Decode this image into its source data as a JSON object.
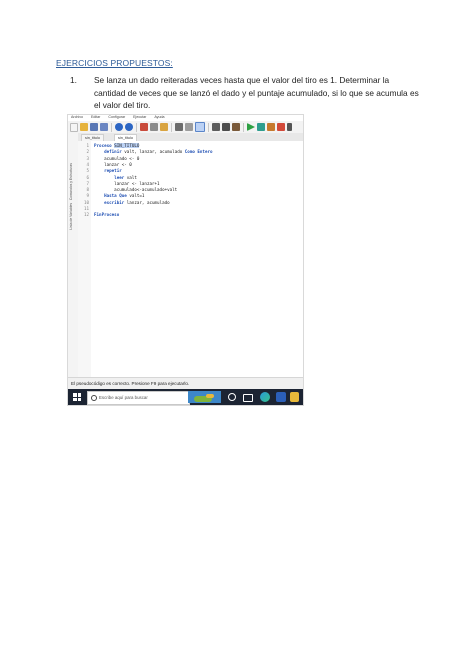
{
  "document": {
    "heading": "EJERCICIOS PROPUESTOS:",
    "item_number": "1.",
    "item_text": "Se lanza un dado reiteradas veces hasta que el valor del tiro es 1. Determinar la cantidad de veces que se lanzó el dado y el puntaje acumulado, si lo que se acumula es el valor del tiro."
  },
  "screenshot": {
    "menu": [
      "Archivo",
      "Editar",
      "Configurar",
      "Ejecutar",
      "Ayuda"
    ],
    "tabs": [
      "sin_titulo",
      "sin_titulo"
    ],
    "side_labels": [
      "Lista de Variables",
      "Comandos y Estructuras"
    ],
    "code_lines": [
      {
        "n": "1",
        "text": "Proceso SIN_TITULO"
      },
      {
        "n": "2",
        "text": "    definir valt, lanzar, acumulado Como Entero"
      },
      {
        "n": "3",
        "text": "    acumulado <- 0"
      },
      {
        "n": "4",
        "text": "    lanzar <- 0"
      },
      {
        "n": "5",
        "text": "    repetir"
      },
      {
        "n": "6",
        "text": "        leer valt"
      },
      {
        "n": "7",
        "text": "        lanzar <- lanzar+1"
      },
      {
        "n": "8",
        "text": "        acumulado<-acumulado+valt"
      },
      {
        "n": "9",
        "text": "    Hasta Que valt=1"
      },
      {
        "n": "10",
        "text": "    escribir lanzar, acumulado"
      },
      {
        "n": "11",
        "text": ""
      },
      {
        "n": "12",
        "text": "FinProceso"
      }
    ],
    "status": "El pseudocódigo es correcto. Presione F9 para ejecutarlo.",
    "taskbar_search": "Escribe aquí para buscar"
  },
  "colors": {
    "heading": "#2e5c99",
    "keyword": "#1f4fb3",
    "taskbar": "#1c2433"
  }
}
